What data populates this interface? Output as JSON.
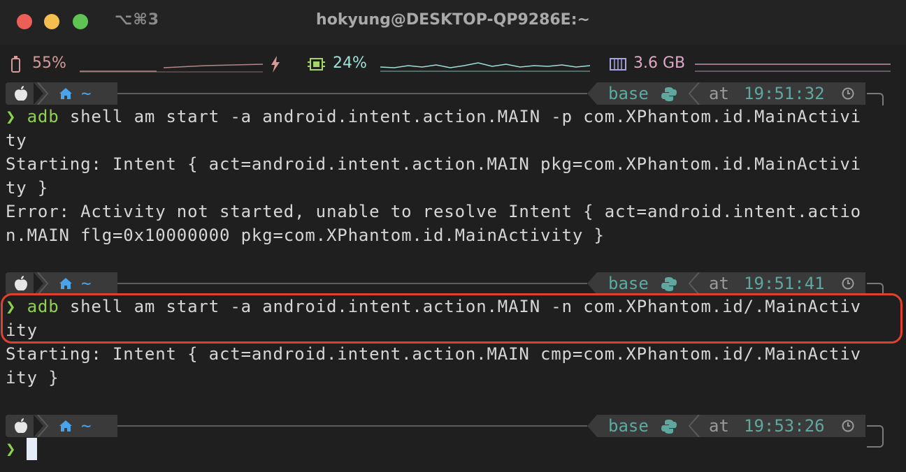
{
  "window": {
    "shortcut": "⌥⌘3",
    "title": "hokyung@DESKTOP-QP9286E:~"
  },
  "status": {
    "battery": "55%",
    "cpu": "24%",
    "memory": "3.6 GB"
  },
  "prompts": [
    {
      "env": "base",
      "at": "at",
      "time": "19:51:32"
    },
    {
      "env": "base",
      "at": "at",
      "time": "19:51:41"
    },
    {
      "env": "base",
      "at": "at",
      "time": "19:53:26"
    }
  ],
  "output": {
    "l1_cmd": "adb",
    "l1_rest": " shell am start -a android.intent.action.MAIN -p com.XPhantom.id.MainActivi",
    "l2": "ty",
    "l3": "Starting: Intent { act=android.intent.action.MAIN pkg=com.XPhantom.id.MainActivi",
    "l4": "ty }",
    "l5": "Error: Activity not started, unable to resolve Intent { act=android.intent.actio",
    "l6": "n.MAIN flg=0x10000000 pkg=com.XPhantom.id.MainActivity }",
    "l7_cmd": "adb",
    "l7_rest": " shell am start -a android.intent.action.MAIN -n com.XPhantom.id/.MainActiv",
    "l8": "ity",
    "l9": "Starting: Intent { act=android.intent.action.MAIN cmp=com.XPhantom.id/.MainActiv",
    "l10": "ity }"
  },
  "prompt_symbol": "❯",
  "home_symbol": "~",
  "colors": {
    "green": "#8fd14f",
    "teal": "#5fa8a0",
    "highlight": "#e0412f",
    "close": "#ec5f57",
    "minimize": "#f5be4f",
    "zoom": "#5fc454"
  }
}
